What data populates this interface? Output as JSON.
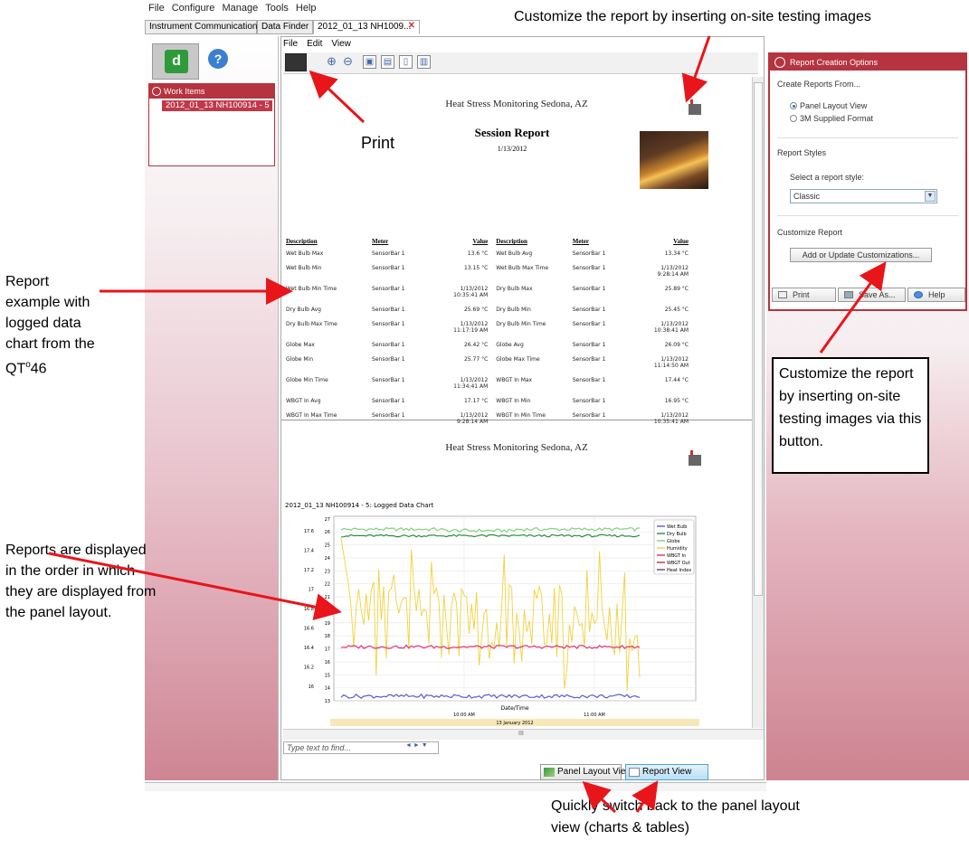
{
  "menubar": {
    "items": [
      "File",
      "Configure",
      "Manage",
      "Tools",
      "Help"
    ]
  },
  "tabs": {
    "instrument": "Instrument Communications",
    "data_finder": "Data Finder",
    "session": "2012_01_13 NH1009..."
  },
  "left": {
    "work_items_header": "Work Items",
    "work_item": "2012_01_13 NH100914 - 5",
    "help_glyph": "?",
    "app_glyph": "d"
  },
  "center": {
    "menu": [
      "File",
      "Edit",
      "View"
    ],
    "toolbar_icons": [
      "print-icon",
      "zoom-in-icon",
      "zoom-out-icon",
      "fit-page-icon",
      "fit-width-icon",
      "single-page-icon",
      "two-page-icon"
    ],
    "report1": {
      "site": "Heat Stress Monitoring Sedona, AZ",
      "title": "Session Report",
      "date": "1/13/2012",
      "headers": [
        "Description",
        "Meter",
        "Value",
        "Description",
        "Meter",
        "Value"
      ],
      "rows": [
        [
          "Wet Bulb Max",
          "SensorBar 1",
          "13.6 °C",
          "Wet Bulb Avg",
          "SensorBar 1",
          "13.34 °C"
        ],
        [
          "Wet Bulb Min",
          "SensorBar 1",
          "13.15 °C",
          "Wet Bulb Max Time",
          "SensorBar 1",
          "1/13/2012\n9:28:14 AM"
        ],
        [
          "Wet Bulb Min Time",
          "SensorBar 1",
          "1/13/2012\n10:35:41 AM",
          "Dry Bulb Max",
          "SensorBar 1",
          "25.89 °C"
        ],
        [
          "Dry Bulb Avg",
          "SensorBar 1",
          "25.69 °C",
          "Dry Bulb Min",
          "SensorBar 1",
          "25.45 °C"
        ],
        [
          "Dry Bulb Max Time",
          "SensorBar 1",
          "1/13/2012\n11:17:19 AM",
          "Dry Bulb Min Time",
          "SensorBar 1",
          "1/13/2012\n10:38:41 AM"
        ],
        [
          "Globe Max",
          "SensorBar 1",
          "26.42 °C",
          "Globe Avg",
          "SensorBar 1",
          "26.09 °C"
        ],
        [
          "Globe Min",
          "SensorBar 1",
          "25.77 °C",
          "Globe Max Time",
          "SensorBar 1",
          "1/13/2012\n11:14:50 AM"
        ],
        [
          "Globe Min Time",
          "SensorBar 1",
          "1/13/2012\n11:34:41 AM",
          "WBGT In Max",
          "SensorBar 1",
          "17.44 °C"
        ],
        [
          "WBGT In Avg",
          "SensorBar 1",
          "17.17 °C",
          "WBGT In Min",
          "SensorBar 1",
          "16.95 °C"
        ],
        [
          "WBGT In Max Time",
          "SensorBar 1",
          "1/13/2012\n9:28:14 AM",
          "WBGT In Min Time",
          "SensorBar 1",
          "1/13/2012\n10:35:41 AM"
        ]
      ]
    },
    "report2": {
      "site": "Heat Stress Monitoring Sedona, AZ",
      "chart_caption": "2012_01_13 NH100914 - 5: Logged Data Chart",
      "xaxis_title": "Date/Time",
      "date_band": "13 January 2012"
    },
    "hscroll_glyph": "III",
    "find_placeholder": "Type text to find...",
    "find_nav": "◄ ► ▼",
    "panel_layout_btn": "Panel Layout View",
    "report_view_btn": "Report View"
  },
  "right": {
    "header": "Report Creation Options",
    "create_from": "Create Reports From...",
    "option_panel": "Panel Layout View",
    "option_3m": "3M Supplied Format",
    "styles_title": "Report Styles",
    "select_label": "Select a report style:",
    "style_value": "Classic",
    "customize_title": "Customize Report",
    "customize_btn": "Add or Update Customizations...",
    "print_btn": "Print",
    "save_btn": "Save As...",
    "help_btn": "Help"
  },
  "annotations": {
    "top": "Customize the report by inserting on-site testing images",
    "print": "Print",
    "left1": "Report example with logged data chart from the QT⁰ 46",
    "left2": "Reports are displayed in the order in which they are displayed from the panel layout.",
    "box": "Customize the report by inserting on-site testing images via this button.",
    "bottom": "Quickly switch back to the panel layout view (charts & tables)"
  },
  "chart_data": {
    "type": "line",
    "title": "2012_01_13 NH100914 - 5: Logged Data Chart",
    "xlabel": "Date/Time",
    "x_ticks": [
      "10:00 AM",
      "11:00 AM"
    ],
    "y_left_ticks": [
      16,
      16.2,
      16.4,
      16.6,
      16.8,
      17,
      17.2,
      17.4,
      17.6
    ],
    "y_right_ticks": [
      13,
      14,
      15,
      16,
      17,
      18,
      19,
      20,
      21,
      22,
      23,
      24,
      25,
      26,
      27
    ],
    "legend": [
      "Wet Bulb",
      "Dry Bulb",
      "Globe",
      "Humidity",
      "WBGT In",
      "WBGT Out",
      "Heat Index"
    ],
    "legend_position": "top-right",
    "series": [
      {
        "name": "Globe",
        "color": "#7fd07f",
        "approx": 26.2
      },
      {
        "name": "Dry Bulb",
        "color": "#2e8b3a",
        "approx": 25.7
      },
      {
        "name": "Humidity",
        "color": "#f2d13a",
        "approx": "varies 13–26"
      },
      {
        "name": "WBGT In",
        "color": "#e0306a",
        "approx": 17.2
      },
      {
        "name": "Wet Bulb",
        "color": "#5a5ad0",
        "approx": 13.3
      }
    ],
    "grid": true
  },
  "colors": {
    "accent": "#b5343f",
    "arrow": "#e8151b"
  }
}
